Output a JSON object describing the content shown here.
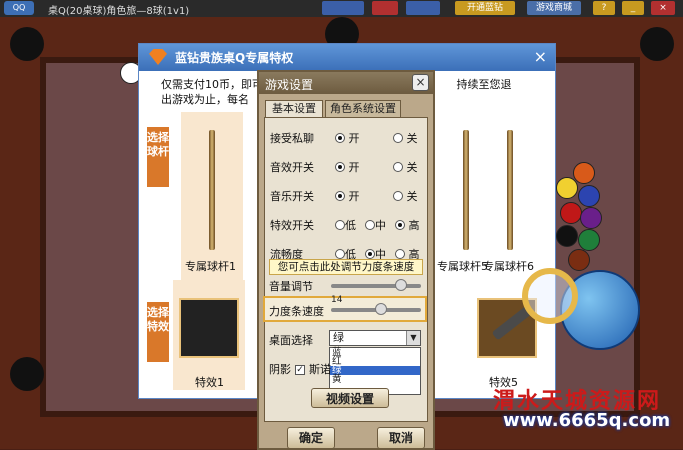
{
  "topbar": {
    "title": "桌Q(20桌球)角色旅—8球(1v1)",
    "buttons": [
      "开通蓝钻",
      "游戏商城"
    ],
    "small_buttons": [
      "?",
      "_",
      "×"
    ]
  },
  "promo": {
    "title": "蓝钻贵族桌Q专属特权",
    "intro_line1": "仅需支付10币，即可",
    "intro_line1_tail": "持续至您退",
    "intro_line2": "出游戏为止，每名",
    "side_cue": "选择球杆",
    "side_effect": "选择特效",
    "cues": [
      "专属球杆1",
      "专属球杆5",
      "专属球杆6"
    ],
    "effects": [
      "特效1",
      "特效5"
    ]
  },
  "dialog": {
    "title": "游戏设置",
    "close": "×",
    "tabs": [
      "基本设置",
      "角色系统设置"
    ],
    "rows": [
      {
        "label": "接受私聊",
        "opts": [
          "开",
          "关"
        ],
        "sel": 0
      },
      {
        "label": "音效开关",
        "opts": [
          "开",
          "关"
        ],
        "sel": 0
      },
      {
        "label": "音乐开关",
        "opts": [
          "开",
          "关"
        ],
        "sel": 0
      },
      {
        "label": "特效开关",
        "opts": [
          "低",
          "中",
          "高"
        ],
        "sel": 2
      },
      {
        "label": "流畅度",
        "opts": [
          "低",
          "中",
          "高"
        ],
        "sel": 1
      }
    ],
    "tooltip": "您可点击此处调节力度条速度",
    "volume_label": "音量调节",
    "power_label": "力度条速度",
    "power_value": "14",
    "table_label": "桌面选择",
    "table_value": "绿",
    "table_options": [
      "蓝",
      "红",
      "绿",
      "黄"
    ],
    "table_selected_index": 2,
    "shadow_label": "阴影",
    "shadow_checked": true,
    "shadow_extra": "斯诺",
    "video_button": "视频设置",
    "ok": "确定",
    "cancel": "取消"
  },
  "watermark": {
    "line1": "渭水天城资源网",
    "line2": "www.6665q.com"
  }
}
